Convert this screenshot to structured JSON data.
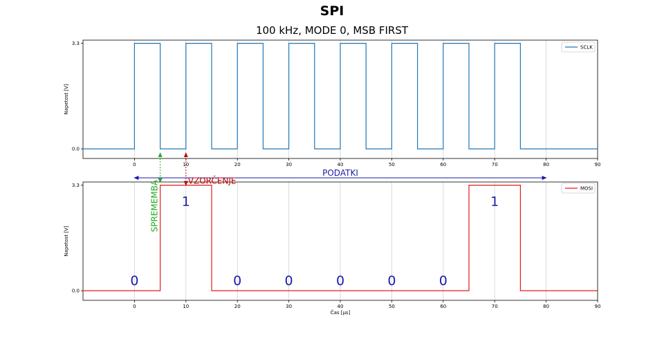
{
  "header": {
    "title": "SPI",
    "subtitle": "100 kHz, MODE 0, MSB FIRST"
  },
  "colors": {
    "sclk": "#1f77b4",
    "mosi": "#e31a1c",
    "bits": "#1a1aa8",
    "data_arrow": "#1a1aa8",
    "sample_arrow": "#c00000",
    "change_arrow": "#22aa22",
    "grid": "#d0d0d0"
  },
  "chart_data": [
    {
      "type": "line",
      "series": [
        {
          "name": "SCLK",
          "x": [
            -10,
            0,
            0,
            5,
            5,
            10,
            10,
            15,
            15,
            20,
            20,
            25,
            25,
            30,
            30,
            35,
            35,
            40,
            40,
            45,
            45,
            50,
            50,
            55,
            55,
            60,
            60,
            65,
            65,
            70,
            70,
            75,
            75,
            80,
            80,
            90
          ],
          "y": [
            0,
            0,
            3.3,
            3.3,
            0,
            0,
            3.3,
            3.3,
            0,
            0,
            3.3,
            3.3,
            0,
            0,
            3.3,
            3.3,
            0,
            0,
            3.3,
            3.3,
            0,
            0,
            3.3,
            3.3,
            0,
            0,
            3.3,
            3.3,
            0,
            0,
            3.3,
            3.3,
            0,
            0,
            0,
            0
          ]
        }
      ],
      "xlim": [
        -10,
        90
      ],
      "ylim": [
        -0.3,
        3.4
      ],
      "xticks": [
        0,
        10,
        20,
        30,
        40,
        50,
        60,
        70,
        80,
        90
      ],
      "yticks": [
        0.0,
        3.3
      ],
      "ytick_labels": [
        "0.0",
        "3.3"
      ],
      "ylabel": "Napetost [V]",
      "xlabel": "",
      "grid": "x",
      "legend": "top-right"
    },
    {
      "type": "line",
      "series": [
        {
          "name": "MOSI",
          "x": [
            -10,
            5,
            5,
            15,
            15,
            65,
            65,
            75,
            75,
            90
          ],
          "y": [
            0,
            0,
            3.3,
            3.3,
            0,
            0,
            3.3,
            3.3,
            0,
            0
          ]
        }
      ],
      "xlim": [
        -10,
        90
      ],
      "ylim": [
        -0.3,
        3.4
      ],
      "xticks": [
        0,
        10,
        20,
        30,
        40,
        50,
        60,
        70,
        80,
        90
      ],
      "yticks": [
        0.0,
        3.3
      ],
      "ytick_labels": [
        "0.0",
        "3.3"
      ],
      "ylabel": "Napetost [V]",
      "xlabel": "Čas [μs]",
      "grid": "x",
      "legend": "top-right",
      "bits": [
        {
          "x": 10,
          "label": "1"
        },
        {
          "x": 0,
          "label": "0"
        },
        {
          "x": 20,
          "label": "0"
        },
        {
          "x": 30,
          "label": "0"
        },
        {
          "x": 40,
          "label": "0"
        },
        {
          "x": 50,
          "label": "0"
        },
        {
          "x": 60,
          "label": "0"
        },
        {
          "x": 70,
          "label": "1"
        }
      ],
      "annotations": {
        "data_label": "PODATKI",
        "data_from": 0,
        "data_to": 80,
        "sample_label": "VZORČENJE",
        "sample_x": 10,
        "change_label": "SPREMEMBA",
        "change_x": 5
      }
    }
  ]
}
